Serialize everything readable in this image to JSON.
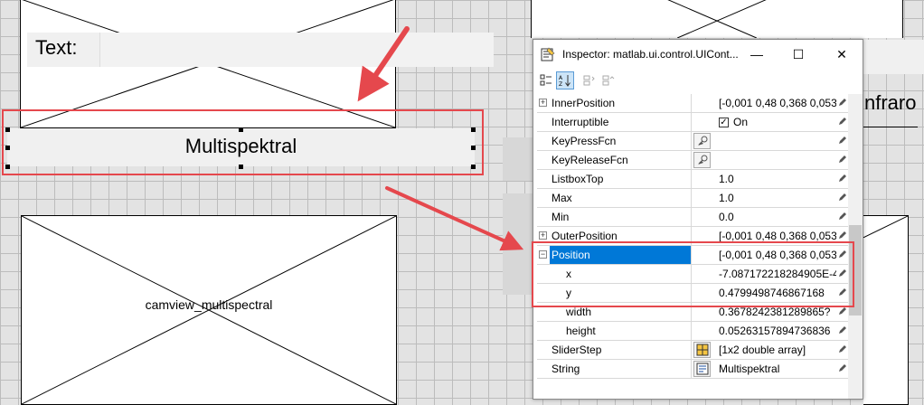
{
  "canvas": {
    "text_label": "Text:",
    "multispectral_label": "Multispektral",
    "camview_caption": "camview_multispectral",
    "partial_label_right": "nfraro"
  },
  "inspector": {
    "title": "Inspector:  matlab.ui.control.UICont...",
    "minimize_glyph": "—",
    "maximize_glyph": "☐",
    "close_glyph": "✕",
    "properties": [
      {
        "name": "InnerPosition",
        "value": "[-0,001 0,48 0,368 0,053]",
        "expander": "+",
        "indent": 0,
        "editor": ""
      },
      {
        "name": "Interruptible",
        "value": "On",
        "checkbox": true,
        "indent": 0,
        "editor": ""
      },
      {
        "name": "KeyPressFcn",
        "value": "",
        "indent": 0,
        "editor": "callback"
      },
      {
        "name": "KeyReleaseFcn",
        "value": "",
        "indent": 0,
        "editor": "callback"
      },
      {
        "name": "ListboxTop",
        "value": "1.0",
        "indent": 0,
        "editor": ""
      },
      {
        "name": "Max",
        "value": "1.0",
        "indent": 0,
        "editor": ""
      },
      {
        "name": "Min",
        "value": "0.0",
        "indent": 0,
        "editor": ""
      },
      {
        "name": "OuterPosition",
        "value": "[-0,001 0,48 0,368 0,053]",
        "expander": "+",
        "indent": 0,
        "editor": ""
      },
      {
        "name": "Position",
        "value": "[-0,001 0,48 0,368 0,053]",
        "expander": "−",
        "indent": 0,
        "editor": "",
        "selected": true
      },
      {
        "name": "x",
        "value": "-7.087172218284905E-4",
        "indent": 1,
        "editor": ""
      },
      {
        "name": "y",
        "value": "0.4799498746867168",
        "indent": 1,
        "editor": ""
      },
      {
        "name": "width",
        "value": "0.3678242381289865?",
        "indent": 1,
        "editor": ""
      },
      {
        "name": "height",
        "value": "0.05263157894736836",
        "indent": 1,
        "editor": ""
      },
      {
        "name": "SliderStep",
        "value": "[1x2  double array]",
        "indent": 0,
        "editor": "array"
      },
      {
        "name": "String",
        "value": "Multispektral",
        "indent": 0,
        "editor": "text"
      }
    ]
  },
  "colors": {
    "annotation_red": "#e5484d",
    "selection_blue": "#0078d7"
  }
}
